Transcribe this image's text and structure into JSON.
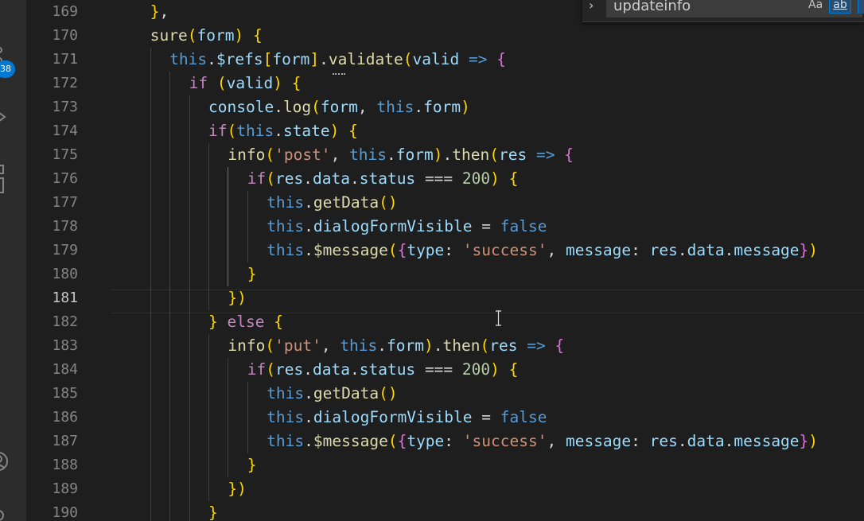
{
  "activity_bar": {
    "badge": "38",
    "icons": [
      "source-control-icon",
      "run-debug-icon",
      "extensions-icon",
      "account-icon",
      "settings-icon"
    ]
  },
  "find_widget": {
    "toggle_glyph": "›",
    "query": "updateinfo",
    "match_case_label": "Aa",
    "match_word_label": "ab"
  },
  "editor": {
    "active_line": 181,
    "line_numbers": [
      "169",
      "170",
      "171",
      "172",
      "173",
      "174",
      "175",
      "176",
      "177",
      "178",
      "179",
      "180",
      "181",
      "182",
      "183",
      "184",
      "185",
      "186",
      "187",
      "188",
      "189",
      "190"
    ],
    "lines": [
      {
        "number": "169",
        "text": "    },"
      },
      {
        "number": "170",
        "text": "    sure(form) {"
      },
      {
        "number": "171",
        "text": "      this.$refs[form].validate(valid => {"
      },
      {
        "number": "172",
        "text": "        if (valid) {"
      },
      {
        "number": "173",
        "text": "          console.log(form, this.form)"
      },
      {
        "number": "174",
        "text": "          if(this.state) {"
      },
      {
        "number": "175",
        "text": "            info('post', this.form).then(res => {"
      },
      {
        "number": "176",
        "text": "              if(res.data.status === 200) {"
      },
      {
        "number": "177",
        "text": "                this.getData()"
      },
      {
        "number": "178",
        "text": "                this.dialogFormVisible = false"
      },
      {
        "number": "179",
        "text": "                this.$message({type: 'success', message: res.data.message})"
      },
      {
        "number": "180",
        "text": "              }"
      },
      {
        "number": "181",
        "text": "            })"
      },
      {
        "number": "182",
        "text": "          } else {"
      },
      {
        "number": "183",
        "text": "            info('put', this.form).then(res => {"
      },
      {
        "number": "184",
        "text": "              if(res.data.status === 200) {"
      },
      {
        "number": "185",
        "text": "                this.getData()"
      },
      {
        "number": "186",
        "text": "                this.dialogFormVisible = false"
      },
      {
        "number": "187",
        "text": "                this.$message({type: 'success', message: res.data.message})"
      },
      {
        "number": "188",
        "text": "              }"
      },
      {
        "number": "189",
        "text": "            })"
      },
      {
        "number": "190",
        "text": "          }"
      }
    ]
  },
  "colors": {
    "background": "#1e1e1e",
    "keyword": "#c586c0",
    "this": "#569cd6",
    "function": "#dcdcaa",
    "variable": "#9cdcfe",
    "string": "#ce9178",
    "number": "#b5cea8",
    "bracket_1": "#ffd700",
    "bracket_2": "#da70d6",
    "bracket_3": "#179fff",
    "badge": "#0078d4"
  }
}
